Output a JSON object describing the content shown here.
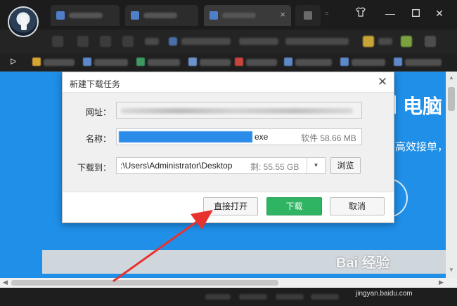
{
  "dialog": {
    "title": "新建下载任务",
    "url_label": "网址：",
    "name_label": "名称：",
    "name_ext": "exe",
    "name_meta": "软件 58.66 MB",
    "save_label": "下载到：",
    "save_path": ":\\Users\\Administrator\\Desktop",
    "free_space": "剩: 55.55 GB",
    "browse_label": "浏览",
    "open_direct_label": "直接打开",
    "download_label": "下载",
    "cancel_label": "取消"
  },
  "page": {
    "heading_fragment": "电脑",
    "subtitle_fragment": "高效接单，"
  },
  "watermark": {
    "text": "Bai 经验",
    "url": "jingyan.baidu.com"
  },
  "colors": {
    "page_blue": "#1f8fe8",
    "download_green": "#2fb463",
    "annotation_red": "#e8322f",
    "selection_blue": "#2b8be8"
  },
  "icons": {
    "dialog_close": "close-icon",
    "dropdown": "chevron-down-icon",
    "bookmarks_toggle": "play-icon",
    "window_skin": "shirt-icon",
    "window_minimize": "minimize-icon",
    "window_maximize": "maximize-icon",
    "window_close": "close-icon"
  }
}
